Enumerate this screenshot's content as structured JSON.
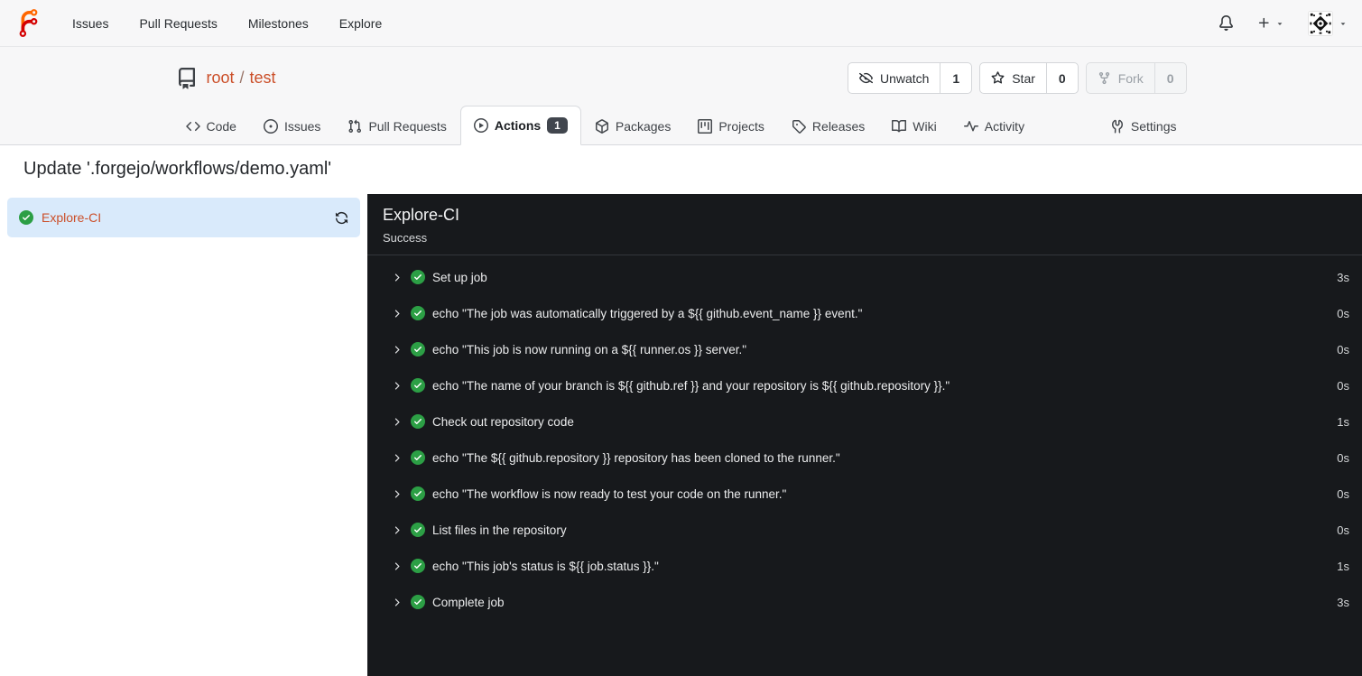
{
  "colors": {
    "primary": "#cb4f29",
    "success": "#2c9f45",
    "sidebar_active_bg": "#d9eafb",
    "panel_bg": "#17191c",
    "badge_bg": "#41464e",
    "header_bg": "#f7f7f8"
  },
  "navbar": {
    "links": [
      {
        "label": "Issues"
      },
      {
        "label": "Pull Requests"
      },
      {
        "label": "Milestones"
      },
      {
        "label": "Explore"
      }
    ],
    "icons": {
      "logo": "forgejo-logo",
      "bell": "bell-icon",
      "plus": "plus-icon",
      "caret": "triangle-down-icon",
      "avatar": "user-avatar-identicon"
    }
  },
  "repo_header": {
    "owner": "root",
    "separator": "/",
    "name": "test",
    "icon": "repo-icon",
    "actions": [
      {
        "label": "Unwatch",
        "count": "1",
        "icon": "eye-closed-icon",
        "disabled": false
      },
      {
        "label": "Star",
        "count": "0",
        "icon": "star-icon",
        "disabled": false
      },
      {
        "label": "Fork",
        "count": "0",
        "icon": "repo-forked-icon",
        "disabled": true
      }
    ]
  },
  "tabs": [
    {
      "label": "Code",
      "icon": "code-icon",
      "active": false
    },
    {
      "label": "Issues",
      "icon": "issue-opened-icon",
      "active": false
    },
    {
      "label": "Pull Requests",
      "icon": "git-pull-request-icon",
      "active": false
    },
    {
      "label": "Actions",
      "icon": "play-circle-icon",
      "badge": "1",
      "active": true
    },
    {
      "label": "Packages",
      "icon": "package-icon",
      "active": false
    },
    {
      "label": "Projects",
      "icon": "project-icon",
      "active": false
    },
    {
      "label": "Releases",
      "icon": "tag-icon",
      "active": false
    },
    {
      "label": "Wiki",
      "icon": "book-icon",
      "active": false
    },
    {
      "label": "Activity",
      "icon": "pulse-icon",
      "active": false
    },
    {
      "label": "Settings",
      "icon": "tools-icon",
      "active": false
    }
  ],
  "run": {
    "commit_title": "Update '.forgejo/workflows/demo.yaml'",
    "jobs": [
      {
        "name": "Explore-CI",
        "status": "success",
        "status_icon": "check-circle-icon",
        "rerun_icon": "sync-icon"
      }
    ],
    "panel": {
      "job_name": "Explore-CI",
      "status_text": "Success"
    },
    "steps": [
      {
        "name": "Set up job",
        "duration": "3s"
      },
      {
        "name": "echo \"The job was automatically triggered by a ${{ github.event_name }} event.\"",
        "duration": "0s"
      },
      {
        "name": "echo \"This job is now running on a ${{ runner.os }} server.\"",
        "duration": "0s"
      },
      {
        "name": "echo \"The name of your branch is ${{ github.ref }} and your repository is ${{ github.repository }}.\"",
        "duration": "0s"
      },
      {
        "name": "Check out repository code",
        "duration": "1s"
      },
      {
        "name": "echo \"The ${{ github.repository }} repository has been cloned to the runner.\"",
        "duration": "0s"
      },
      {
        "name": "echo \"The workflow is now ready to test your code on the runner.\"",
        "duration": "0s"
      },
      {
        "name": "List files in the repository",
        "duration": "0s"
      },
      {
        "name": "echo \"This job's status is ${{ job.status }}.\"",
        "duration": "1s"
      },
      {
        "name": "Complete job",
        "duration": "3s"
      }
    ]
  }
}
